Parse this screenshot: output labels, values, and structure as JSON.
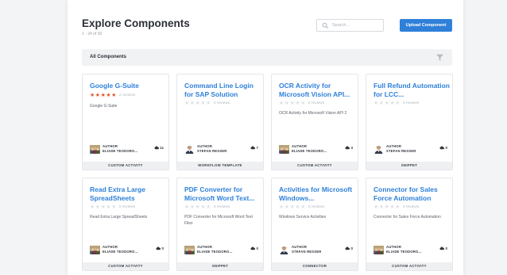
{
  "header": {
    "title": "Explore Components",
    "count": "1 - 24 of 30",
    "search_placeholder": "Search...",
    "upload_label": "Upload Component"
  },
  "filter": {
    "label": "All Components",
    "icon": "filter-icon"
  },
  "colors": {
    "accent": "#2f80d9",
    "star_active": "#e05a2b"
  },
  "cards": [
    {
      "title": "Google G-Suite",
      "rating": 5,
      "reviews": "2 reviews",
      "description": "Google G-Suite",
      "author_label": "AUTHOR",
      "author": "ELIADE TEODORO...",
      "avatar": "group",
      "downloads": "11",
      "type": "CUSTOM ACTIVITY"
    },
    {
      "title": "Command Line Login for SAP Solution",
      "rating": 0,
      "reviews": "0 reviews",
      "description": "",
      "author_label": "AUTHOR",
      "author": "STEFAN RESSER",
      "avatar": "person",
      "downloads": "7",
      "type": "WORKFLOW TEMPLATE"
    },
    {
      "title": "OCR Activity for Microsoft Vision API...",
      "rating": 0,
      "reviews": "0 reviews",
      "description": "OCR Activity for Microsoft Vision API 2",
      "author_label": "AUTHOR",
      "author": "ELIADE TEODORO...",
      "avatar": "group",
      "downloads": "3",
      "type": "CUSTOM ACTIVITY"
    },
    {
      "title": "Full Refund Automation for LCC...",
      "rating": 0,
      "reviews": "0 reviews",
      "description": "",
      "author_label": "AUTHOR",
      "author": "STEFAN RESSER",
      "avatar": "person",
      "downloads": "0",
      "type": "SNIPPET"
    },
    {
      "title": "Read Extra Large SpreadSheets",
      "rating": 0,
      "reviews": "0 reviews",
      "description": "Read Extra Large SpreadSheets",
      "author_label": "AUTHOR",
      "author": "ELIADE TEODORO...",
      "avatar": "group",
      "downloads": "0",
      "type": "CUSTOM ACTIVITY"
    },
    {
      "title": "PDF Converter for Microsoft Word Text...",
      "rating": 0,
      "reviews": "0 reviews",
      "description": "PDF Converter for Microsoft Word Text Files",
      "author_label": "AUTHOR",
      "author": "ELIADE TEODORO...",
      "avatar": "group",
      "downloads": "0",
      "type": "SNIPPET"
    },
    {
      "title": "Activities for Microsoft Windows...",
      "rating": 0,
      "reviews": "0 reviews",
      "description": "Windows Service Activities",
      "author_label": "AUTHOR",
      "author": "STEFAN RESSER",
      "avatar": "person",
      "downloads": "0",
      "type": "CONNECTOR"
    },
    {
      "title": "Connector for Sales Force Automation",
      "rating": 0,
      "reviews": "0 reviews",
      "description": "Connector for Sales Force Automation",
      "author_label": "AUTHOR",
      "author": "ELIADE TEODORO...",
      "avatar": "group",
      "downloads": "0",
      "type": "CUSTOM ACTIVITY"
    }
  ]
}
